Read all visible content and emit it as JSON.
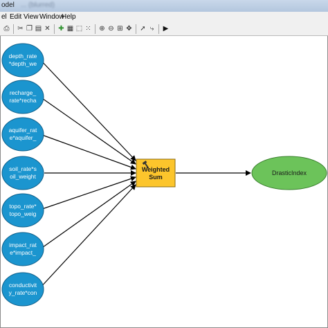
{
  "window": {
    "title": "odel",
    "title_faded": "... (blurred)"
  },
  "menu": [
    "el",
    "Edit",
    "View",
    "Window",
    "Help"
  ],
  "toolbar": {
    "icons": [
      "print-icon",
      "cut-icon",
      "copy-icon",
      "paste-icon",
      "delete-icon",
      "add-data-icon",
      "auto-layout-icon",
      "full-extent-icon",
      "grid-icon",
      "zoom-in-icon",
      "zoom-out-icon",
      "zoom-extent-icon",
      "pan-icon",
      "select-icon",
      "connect-icon",
      "run-icon"
    ]
  },
  "model": {
    "inputs": [
      {
        "line1": "depth_rate",
        "line2": "*depth_we"
      },
      {
        "line1": "recharge_",
        "line2": "rate*recha"
      },
      {
        "line1": "aquifer_rat",
        "line2": "e*aquifer_"
      },
      {
        "line1": "soil_rate*s",
        "line2": "oil_weight"
      },
      {
        "line1": "topo_rate*",
        "line2": "topo_weig"
      },
      {
        "line1": "impact_rat",
        "line2": "e*impact_"
      },
      {
        "line1": "conductivit",
        "line2": "y_rate*con"
      }
    ],
    "tool": {
      "line1": "Weighted",
      "line2": "Sum"
    },
    "output": {
      "label": "DrasticIndex"
    },
    "colors": {
      "input_fill": "#1b95cf",
      "tool_fill": "#fcc52c",
      "output_fill": "#6cc35a",
      "arrow": "#000000"
    }
  }
}
